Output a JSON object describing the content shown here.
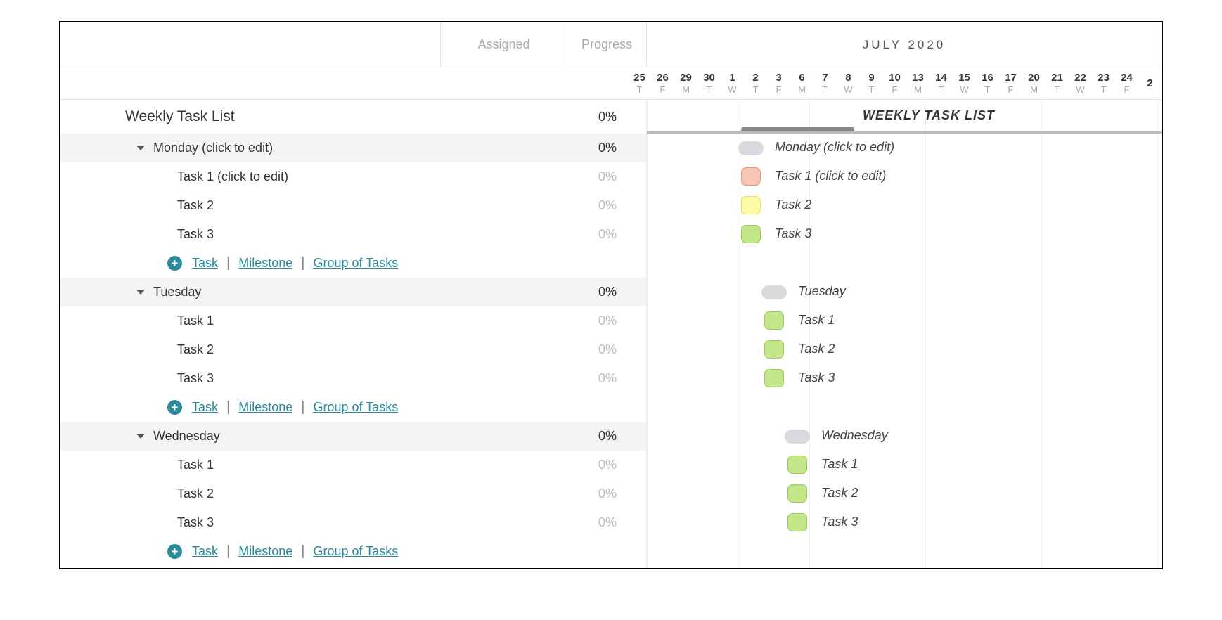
{
  "header": {
    "assigned": "Assigned",
    "progress": "Progress",
    "month": "JULY 2020"
  },
  "dates": [
    {
      "num": "25",
      "dow": "T"
    },
    {
      "num": "26",
      "dow": "F"
    },
    {
      "num": "29",
      "dow": "M"
    },
    {
      "num": "30",
      "dow": "T"
    },
    {
      "num": "1",
      "dow": "W"
    },
    {
      "num": "2",
      "dow": "T"
    },
    {
      "num": "3",
      "dow": "F"
    },
    {
      "num": "6",
      "dow": "M"
    },
    {
      "num": "7",
      "dow": "T"
    },
    {
      "num": "8",
      "dow": "W"
    },
    {
      "num": "9",
      "dow": "T"
    },
    {
      "num": "10",
      "dow": "F"
    },
    {
      "num": "13",
      "dow": "M"
    },
    {
      "num": "14",
      "dow": "T"
    },
    {
      "num": "15",
      "dow": "W"
    },
    {
      "num": "16",
      "dow": "T"
    },
    {
      "num": "17",
      "dow": "F"
    },
    {
      "num": "20",
      "dow": "M"
    },
    {
      "num": "21",
      "dow": "T"
    },
    {
      "num": "22",
      "dow": "W"
    },
    {
      "num": "23",
      "dow": "T"
    },
    {
      "num": "24",
      "dow": "F"
    },
    {
      "num": "2",
      "dow": ""
    }
  ],
  "project": {
    "name": "Weekly Task List",
    "progress": "0%",
    "gantt_title": "WEEKLY TASK LIST"
  },
  "groups": [
    {
      "name": "Monday (click to edit)",
      "progress": "0%",
      "gantt_label": "Monday (click to edit)",
      "tasks": [
        {
          "name": "Task 1 (click to edit)",
          "progress": "0%",
          "gantt_label": "Task 1 (click to edit)",
          "color": "salmon"
        },
        {
          "name": "Task 2",
          "progress": "0%",
          "gantt_label": "Task 2",
          "color": "yellow"
        },
        {
          "name": "Task 3",
          "progress": "0%",
          "gantt_label": "Task 3",
          "color": "green"
        }
      ]
    },
    {
      "name": "Tuesday",
      "progress": "0%",
      "gantt_label": "Tuesday",
      "tasks": [
        {
          "name": "Task 1",
          "progress": "0%",
          "gantt_label": "Task 1",
          "color": "green"
        },
        {
          "name": "Task 2",
          "progress": "0%",
          "gantt_label": "Task 2",
          "color": "green"
        },
        {
          "name": "Task 3",
          "progress": "0%",
          "gantt_label": "Task 3",
          "color": "green"
        }
      ]
    },
    {
      "name": "Wednesday",
      "progress": "0%",
      "gantt_label": "Wednesday",
      "tasks": [
        {
          "name": "Task 1",
          "progress": "0%",
          "gantt_label": "Task 1",
          "color": "green"
        },
        {
          "name": "Task 2",
          "progress": "0%",
          "gantt_label": "Task 2",
          "color": "green"
        },
        {
          "name": "Task 3",
          "progress": "0%",
          "gantt_label": "Task 3",
          "color": "green"
        }
      ]
    }
  ],
  "add_links": {
    "task": "Task",
    "milestone": "Milestone",
    "group": "Group of Tasks"
  }
}
